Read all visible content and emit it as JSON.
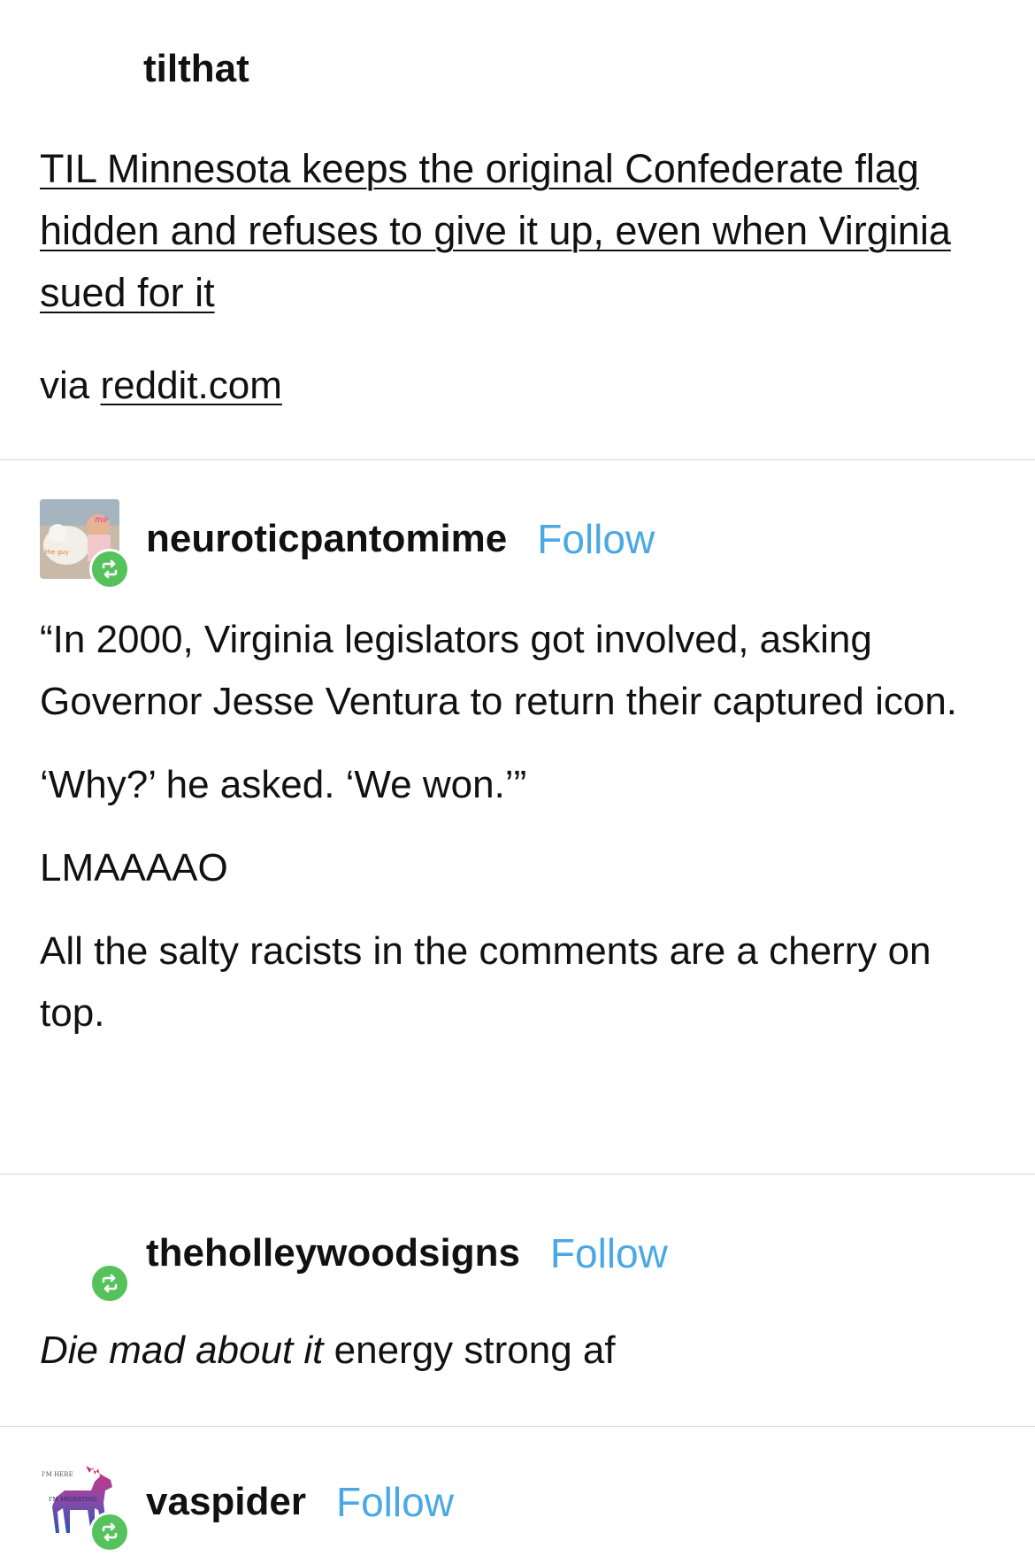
{
  "post1": {
    "username": "tilthat",
    "link_title": "TIL Minnesota keeps the original Confederate flag hidden and refuses to give it up, even when Virginia sued for it",
    "via_prefix": "via ",
    "via_link": "reddit.com"
  },
  "post2": {
    "username": "neuroticpantomime",
    "follow_label": "Follow",
    "paragraphs": [
      "“In 2000, Virginia legislators got involved, asking Governor Jesse Ventura to return their captured icon.",
      "‘Why?’ he asked. ‘We won.’”",
      "LMAAAAO",
      "All the salty racists in the comments are a cherry on top."
    ]
  },
  "post3": {
    "username": "theholleywoodsigns",
    "follow_label": "Follow",
    "text_italic": "Die mad about it",
    "text_rest": " energy strong af"
  },
  "post4": {
    "username": "vaspider",
    "follow_label": "Follow",
    "avatar_text_top": "I'M HERE",
    "avatar_text_mid": "I'M MIGRATING"
  },
  "colors": {
    "follow": "#4aa8e4",
    "reblog_badge": "#55c25c",
    "divider": "#d4d4d4"
  }
}
